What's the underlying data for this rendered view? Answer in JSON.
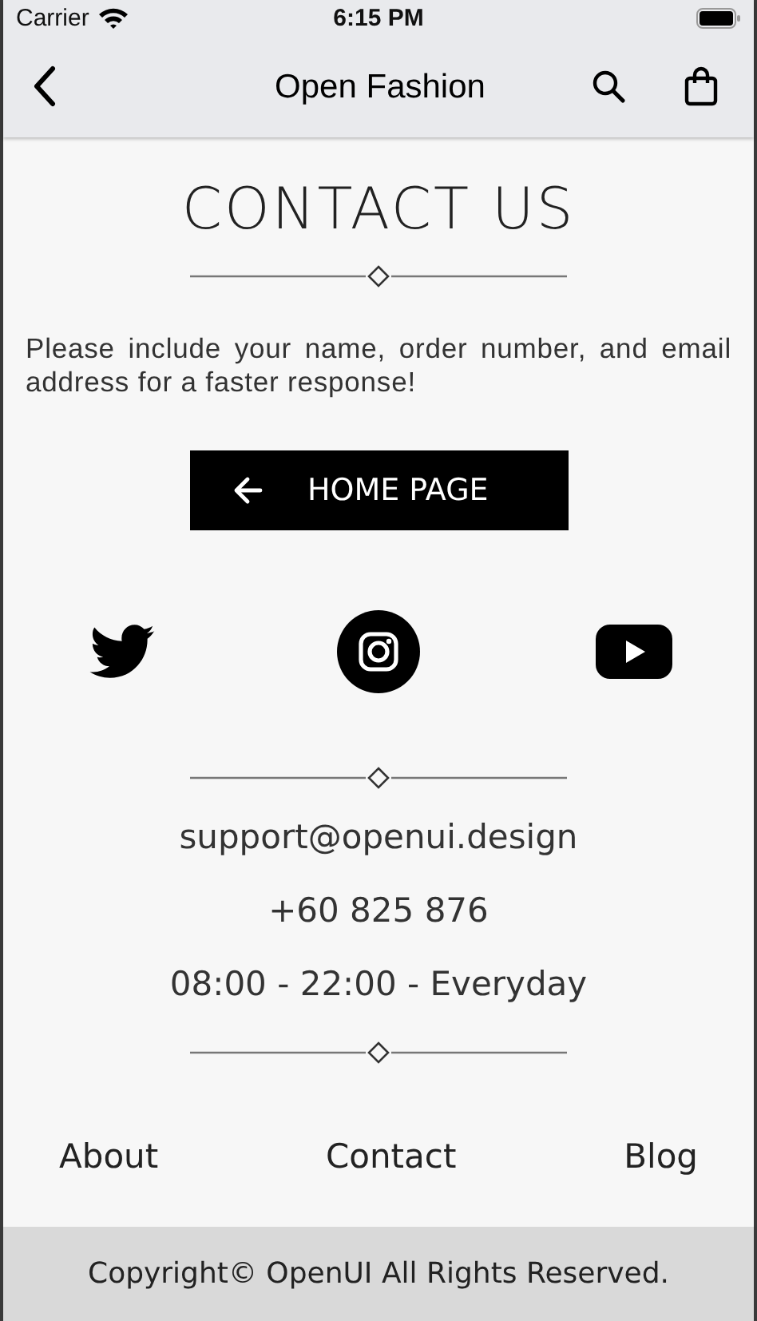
{
  "status_bar": {
    "carrier": "Carrier",
    "time": "6:15 PM"
  },
  "nav_bar": {
    "title": "Open Fashion"
  },
  "title": "CONTACT US",
  "message": "Please include your name, order number, and email address for a faster response!",
  "home_button": {
    "label": "HOME PAGE"
  },
  "social": [
    {
      "kind": "twitter"
    },
    {
      "kind": "instagram"
    },
    {
      "kind": "youtube"
    }
  ],
  "contact": [
    "support@openui.design",
    "+60 825 876",
    "08:00 - 22:00 - Everyday"
  ],
  "footer_links": [
    "About",
    "Contact",
    "Blog"
  ],
  "copyright": "Copyright© OpenUI All Rights Reserved."
}
